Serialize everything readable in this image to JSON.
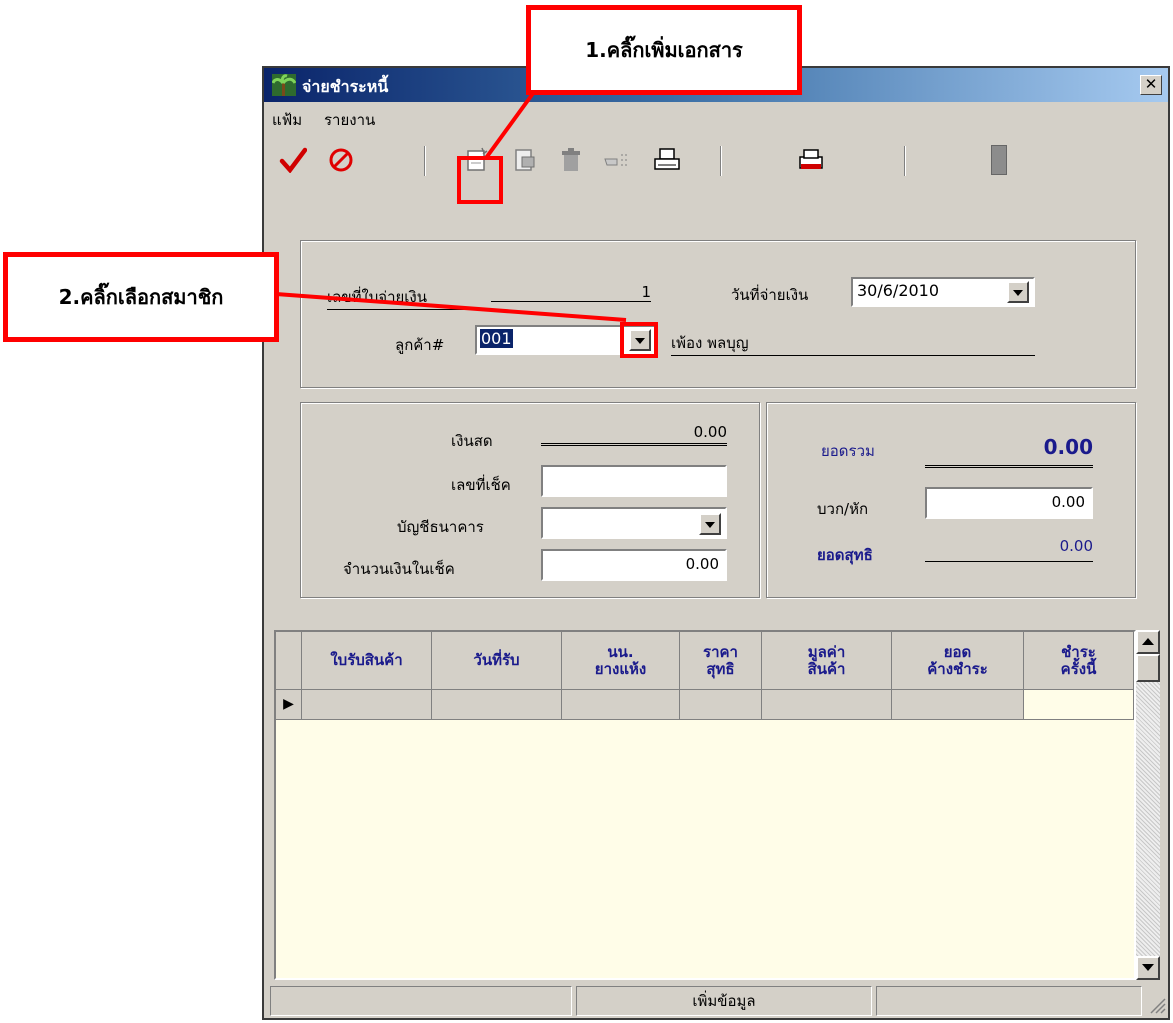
{
  "window": {
    "title": "จ่ายชำระหนี้",
    "close_glyph": "✕"
  },
  "menu": [
    "แฟ้ม",
    "รายงาน"
  ],
  "toolbar": {
    "icons": [
      "check-icon",
      "cancel-icon",
      "new-document-icon",
      "edit-document-icon",
      "delete-icon",
      "search-icon",
      "print-icon",
      "print-preview-icon",
      "exit-icon"
    ]
  },
  "header": {
    "receipt_no_label": "เลขที่ใบจ่ายเงิน",
    "receipt_no_value": "1",
    "pay_date_label": "วันที่จ่ายเงิน",
    "pay_date_value": "30/6/2010",
    "customer_label": "ลูกค้า#",
    "customer_code": "001",
    "customer_name": "เพ้อง พลบุญ"
  },
  "payment": {
    "cash_label": "เงินสด",
    "cash_value": "0.00",
    "cheque_no_label": "เลขที่เช็ค",
    "cheque_no_value": "",
    "bank_account_label": "บัญชีธนาคาร",
    "bank_account_value": "",
    "cheque_amount_label": "จำนวนเงินในเช็ค",
    "cheque_amount_value": "0.00"
  },
  "summary": {
    "total_label": "ยอดรวม",
    "total_value": "0.00",
    "adjust_label": "บวก/หัก",
    "adjust_value": "0.00",
    "net_label": "ยอดสุทธิ",
    "net_value": "0.00",
    "accent_color": "#1a1a8c"
  },
  "grid": {
    "columns": [
      "ใบรับสินค้า",
      "วันที่รับ",
      "นน.\nยางแห้ง",
      "ราคา\nสุทธิ",
      "มูลค่า\nสินค้า",
      "ยอด\nค้างชำระ",
      "ชำระ\nครั้งนี้"
    ],
    "row_indicator": "▶"
  },
  "status": {
    "panel1": "",
    "panel2": "เพิ่มข้อมูล",
    "panel3": ""
  },
  "annotations": {
    "step1": "1.คลิ๊กเพิ่มเอกสาร",
    "step2": "2.คลิ๊กเลือกสมาชิก",
    "color": "#ff0000"
  }
}
